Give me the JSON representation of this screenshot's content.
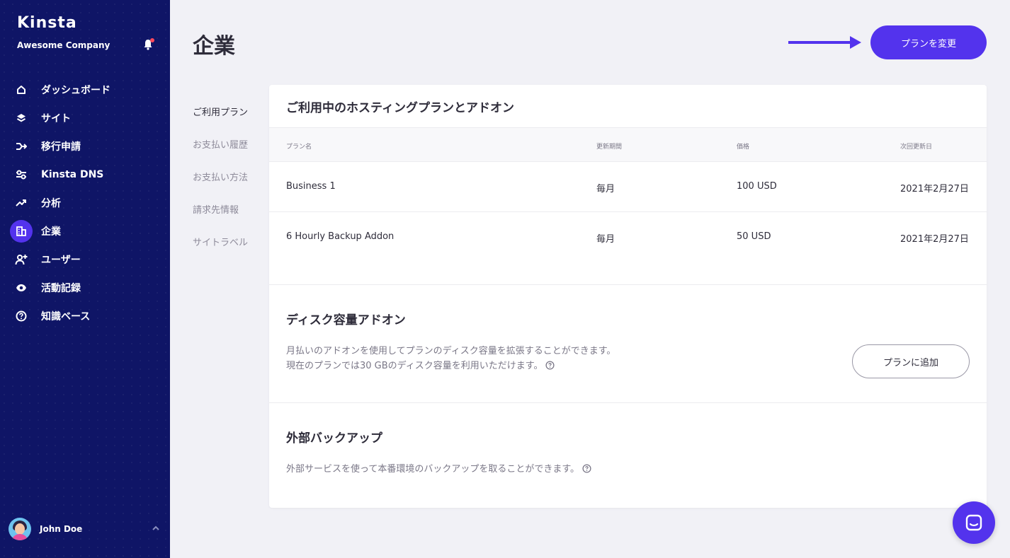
{
  "sidebar": {
    "logo": "Kinsta",
    "company": "Awesome Company",
    "items": [
      {
        "label": "ダッシュボード",
        "icon": "home-icon"
      },
      {
        "label": "サイト",
        "icon": "layers-icon"
      },
      {
        "label": "移行申請",
        "icon": "migration-icon"
      },
      {
        "label": "Kinsta DNS",
        "icon": "dns-icon"
      },
      {
        "label": "分析",
        "icon": "analytics-icon"
      },
      {
        "label": "企業",
        "icon": "company-icon",
        "active": true
      },
      {
        "label": "ユーザー",
        "icon": "add-user-icon"
      },
      {
        "label": "活動記録",
        "icon": "eye-icon"
      },
      {
        "label": "知識ベース",
        "icon": "help-icon"
      }
    ],
    "user": {
      "name": "John Doe"
    }
  },
  "header": {
    "title": "企業",
    "change_plan_label": "プランを変更"
  },
  "subnav": {
    "items": [
      "ご利用プラン",
      "お支払い履歴",
      "お支払い方法",
      "請求先情報",
      "サイトラベル"
    ]
  },
  "plans": {
    "title": "ご利用中のホスティングプランとアドオン",
    "columns": [
      "プラン名",
      "更新期間",
      "価格",
      "次回更新日"
    ],
    "rows": [
      [
        "Business 1",
        "毎月",
        "100 USD",
        "2021年2月27日"
      ],
      [
        "6 Hourly Backup Addon",
        "毎月",
        "50 USD",
        "2021年2月27日"
      ]
    ]
  },
  "disk": {
    "title": "ディスク容量アドオン",
    "line1": "月払いのアドオンを使用してプランのディスク容量を拡張することができます。",
    "line2": "現在のプランでは30 GBのディスク容量を利用いただけます。",
    "button_label": "プランに追加"
  },
  "backup": {
    "title": "外部バックアップ",
    "line1": "外部サービスを使って本番環境のバックアップを取ることができます。"
  },
  "colors": {
    "sidebar_bg": "#0f1566",
    "accent": "#5333ed",
    "page_bg": "#f1f1f6",
    "notification_dot": "#ff4a5c"
  }
}
